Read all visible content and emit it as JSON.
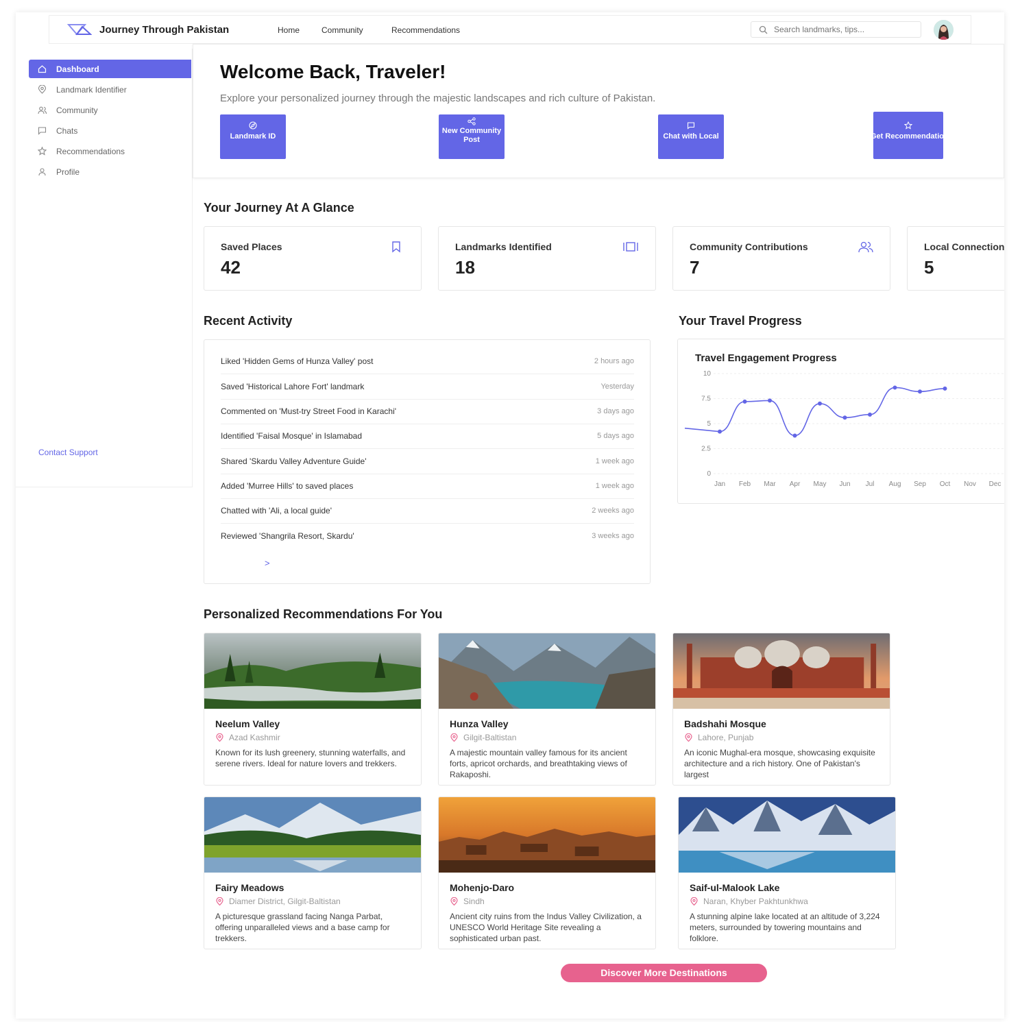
{
  "app": {
    "title": "Journey Through Pakistan",
    "accent_color": "#6366e6",
    "cta_color": "#e7628e"
  },
  "nav": {
    "links": [
      "Home",
      "Community",
      "Recommendations"
    ],
    "search_placeholder": "Search landmarks, tips..."
  },
  "sidebar": {
    "items": [
      {
        "label": "Dashboard",
        "icon": "home-icon",
        "active": true
      },
      {
        "label": "Landmark Identifier",
        "icon": "pin-icon",
        "active": false
      },
      {
        "label": "Community",
        "icon": "users-icon",
        "active": false
      },
      {
        "label": "Chats",
        "icon": "chat-icon",
        "active": false
      },
      {
        "label": "Recommendations",
        "icon": "star-icon",
        "active": false
      },
      {
        "label": "Profile",
        "icon": "user-icon",
        "active": false
      }
    ],
    "contact": "Contact Support"
  },
  "welcome": {
    "title": "Welcome Back, Traveler!",
    "subtitle": "Explore your personalized journey through the majestic landscapes and rich culture of Pakistan.",
    "actions": [
      {
        "label": "Landmark ID",
        "icon": "compass-icon"
      },
      {
        "label": "New Community Post",
        "icon": "share-icon"
      },
      {
        "label": "Chat with Local",
        "icon": "chat-icon"
      },
      {
        "label": "Get Recommendations",
        "icon": "star-icon"
      }
    ]
  },
  "glance": {
    "title": "Your Journey At A Glance",
    "stats": [
      {
        "label": "Saved Places",
        "value": "42",
        "icon": "bookmark-icon"
      },
      {
        "label": "Landmarks Identified",
        "value": "18",
        "icon": "scan-icon"
      },
      {
        "label": "Community Contributions",
        "value": "7",
        "icon": "users-icon"
      },
      {
        "label": "Local Connections",
        "value": "5",
        "icon": "chat-icon"
      }
    ]
  },
  "activity": {
    "title": "Recent Activity",
    "items": [
      {
        "text": "Liked 'Hidden Gems of Hunza Valley' post",
        "time": "2 hours ago"
      },
      {
        "text": "Saved 'Historical Lahore Fort' landmark",
        "time": "Yesterday"
      },
      {
        "text": "Commented on 'Must-try Street Food in Karachi'",
        "time": "3 days ago"
      },
      {
        "text": "Identified 'Faisal Mosque' in Islamabad",
        "time": "5 days ago"
      },
      {
        "text": "Shared 'Skardu Valley Adventure Guide'",
        "time": "1 week ago"
      },
      {
        "text": "Added 'Murree Hills' to saved places",
        "time": "1 week ago"
      },
      {
        "text": "Chatted with 'Ali, a local guide'",
        "time": "2 weeks ago"
      },
      {
        "text": "Reviewed 'Shangrila Resort, Skardu'",
        "time": "3 weeks ago"
      }
    ],
    "more": ">"
  },
  "progress": {
    "title": "Your Travel Progress"
  },
  "chart_data": {
    "type": "line",
    "title": "Travel Engagement Progress",
    "categories": [
      "Jan",
      "Feb",
      "Mar",
      "Apr",
      "May",
      "Jun",
      "Jul",
      "Aug",
      "Sep",
      "Oct",
      "Nov",
      "Dec"
    ],
    "series": [
      {
        "values": [
          4.2,
          7.2,
          7.3,
          3.8,
          7.0,
          5.6,
          5.9,
          8.6,
          8.2,
          8.5
        ]
      }
    ],
    "yticks": [
      "10",
      "7.5",
      "5",
      "2.5",
      "0"
    ],
    "ylim": [
      0,
      10
    ],
    "grid": true,
    "color": "#6366e6"
  },
  "recommendations": {
    "title": "Personalized Recommendations For You",
    "cards": [
      {
        "name": "Neelum Valley",
        "location": "Azad Kashmir",
        "description": "Known for its lush greenery, stunning waterfalls, and serene rivers. Ideal for nature lovers and trekkers."
      },
      {
        "name": "Hunza Valley",
        "location": "Gilgit-Baltistan",
        "description": "A majestic mountain valley famous for its ancient forts, apricot orchards, and breathtaking views of Rakaposhi."
      },
      {
        "name": "Badshahi Mosque",
        "location": "Lahore, Punjab",
        "description": "An iconic Mughal-era mosque, showcasing exquisite architecture and a rich history. One of Pakistan's largest"
      },
      {
        "name": "Fairy Meadows",
        "location": "Diamer District, Gilgit-Baltistan",
        "description": "A picturesque grassland facing Nanga Parbat, offering unparalleled views and a base camp for trekkers."
      },
      {
        "name": "Mohenjo-Daro",
        "location": "Sindh",
        "description": "Ancient city ruins from the Indus Valley Civilization, a UNESCO World Heritage Site revealing a sophisticated urban past."
      },
      {
        "name": "Saif-ul-Malook Lake",
        "location": "Naran, Khyber Pakhtunkhwa",
        "description": "A stunning alpine lake located at an altitude of 3,224 meters, surrounded by towering mountains and folklore."
      }
    ],
    "cta": "Discover More Destinations"
  }
}
